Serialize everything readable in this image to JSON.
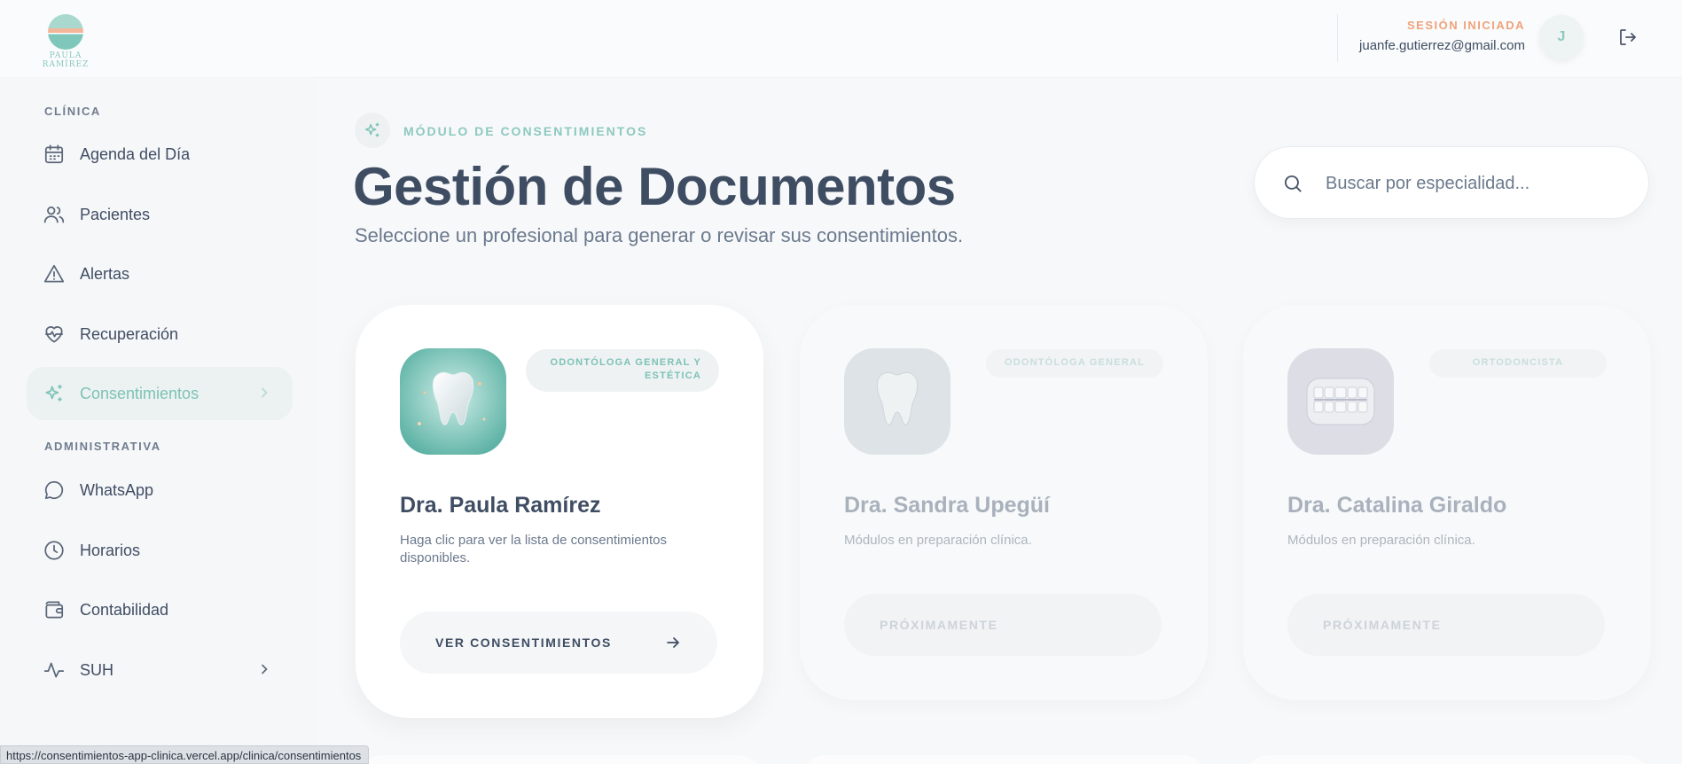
{
  "app": {
    "logo_text": "PAULA RAMÍREZ"
  },
  "header": {
    "session_label": "SESIÓN INICIADA",
    "user_email": "juanfe.gutierrez@gmail.com",
    "avatar_initial": "J",
    "icons": {
      "logout": "logout-icon"
    }
  },
  "sidebar": {
    "sections": [
      {
        "label": "CLÍNICA"
      },
      {
        "label": "ADMINISTRATIVA"
      }
    ],
    "items": [
      {
        "label": "Agenda del Día",
        "icon": "calendar-icon"
      },
      {
        "label": "Pacientes",
        "icon": "users-icon"
      },
      {
        "label": "Alertas",
        "icon": "alert-triangle-icon"
      },
      {
        "label": "Recuperación",
        "icon": "heart-pulse-icon"
      },
      {
        "label": "Consentimientos",
        "icon": "sparkles-icon",
        "active": true
      },
      {
        "label": "WhatsApp",
        "icon": "chat-bubble-icon"
      },
      {
        "label": "Horarios",
        "icon": "clock-icon"
      },
      {
        "label": "Contabilidad",
        "icon": "wallet-icon"
      },
      {
        "label": "SUH",
        "icon": "activity-icon"
      }
    ]
  },
  "main": {
    "module_label": "MÓDULO DE CONSENTIMIENTOS",
    "title": "Gestión de Documentos",
    "subtitle": "Seleccione un profesional para generar o revisar sus consentimientos.",
    "search": {
      "placeholder": "Buscar por especialidad...",
      "value": ""
    },
    "cards": [
      {
        "badge": "ODONTÓLOGA GENERAL Y ESTÉTICA",
        "name": "Dra. Paula Ramírez",
        "description": "Haga clic para ver la lista de consentimientos disponibles.",
        "button": "VER CONSENTIMIENTOS",
        "enabled": true
      },
      {
        "badge": "ODONTÓLOGA GENERAL",
        "name": "Dra. Sandra Upegüí",
        "description": "Módulos en preparación clínica.",
        "button": "PRÓXIMAMENTE",
        "enabled": false
      },
      {
        "badge": "ORTODONCISTA",
        "name": "Dra. Catalina Giraldo",
        "description": "Módulos en preparación clínica.",
        "button": "PRÓXIMAMENTE",
        "enabled": false
      }
    ]
  },
  "status_bar": {
    "url": "https://consentimientos-app-clinica.vercel.app/clinica/consentimientos"
  },
  "colors": {
    "accent": "#8cc9bf",
    "session_label": "#f0a27b",
    "text_primary": "#3f4d63",
    "text_secondary": "#6b7a8d"
  }
}
